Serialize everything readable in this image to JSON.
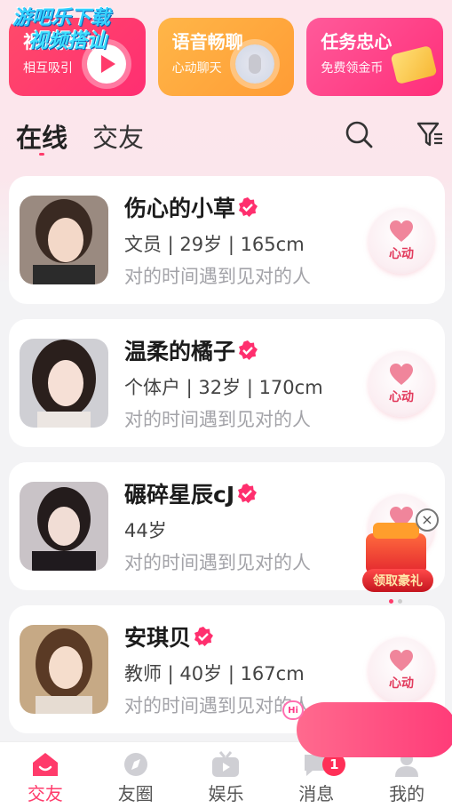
{
  "watermark": {
    "line1": "游吧乐下载",
    "line2": "视频搭讪"
  },
  "banners": [
    {
      "title": "视频搭讪",
      "subtitle": "相互吸引"
    },
    {
      "title": "语音畅聊",
      "subtitle": "心动聊天"
    },
    {
      "title": "任务忠心",
      "subtitle": "免费领金币"
    }
  ],
  "tabs": [
    {
      "label": "在线"
    },
    {
      "label": "交友"
    }
  ],
  "users": [
    {
      "name": "伤心的小草",
      "meta": "文员 | 29岁 | 165cm",
      "motto": "对的时间遇到见对的人",
      "like_label": "心动"
    },
    {
      "name": "温柔的橘子",
      "meta": "个体户 | 32岁 | 170cm",
      "motto": "对的时间遇到见对的人",
      "like_label": "心动"
    },
    {
      "name": "碾碎星辰cJ",
      "meta": "44岁",
      "motto": "对的时间遇到见对的人",
      "like_label": "心动"
    },
    {
      "name": "安琪贝",
      "meta": "教师 | 40岁 | 167cm",
      "motto": "对的时间遇到见对的人",
      "like_label": "心动"
    }
  ],
  "gift": {
    "label": "领取豪礼",
    "close": "×"
  },
  "hi_badge": "Hi",
  "nav": [
    {
      "label": "交友",
      "icon": "home-icon"
    },
    {
      "label": "友圈",
      "icon": "compass-icon"
    },
    {
      "label": "娱乐",
      "icon": "tv-icon"
    },
    {
      "label": "消息",
      "icon": "chat-icon",
      "badge": "1"
    },
    {
      "label": "我的",
      "icon": "profile-icon"
    }
  ],
  "colors": {
    "accent": "#ff3b6b",
    "like_text": "#e23a5c",
    "background": "#f3f3f5"
  }
}
